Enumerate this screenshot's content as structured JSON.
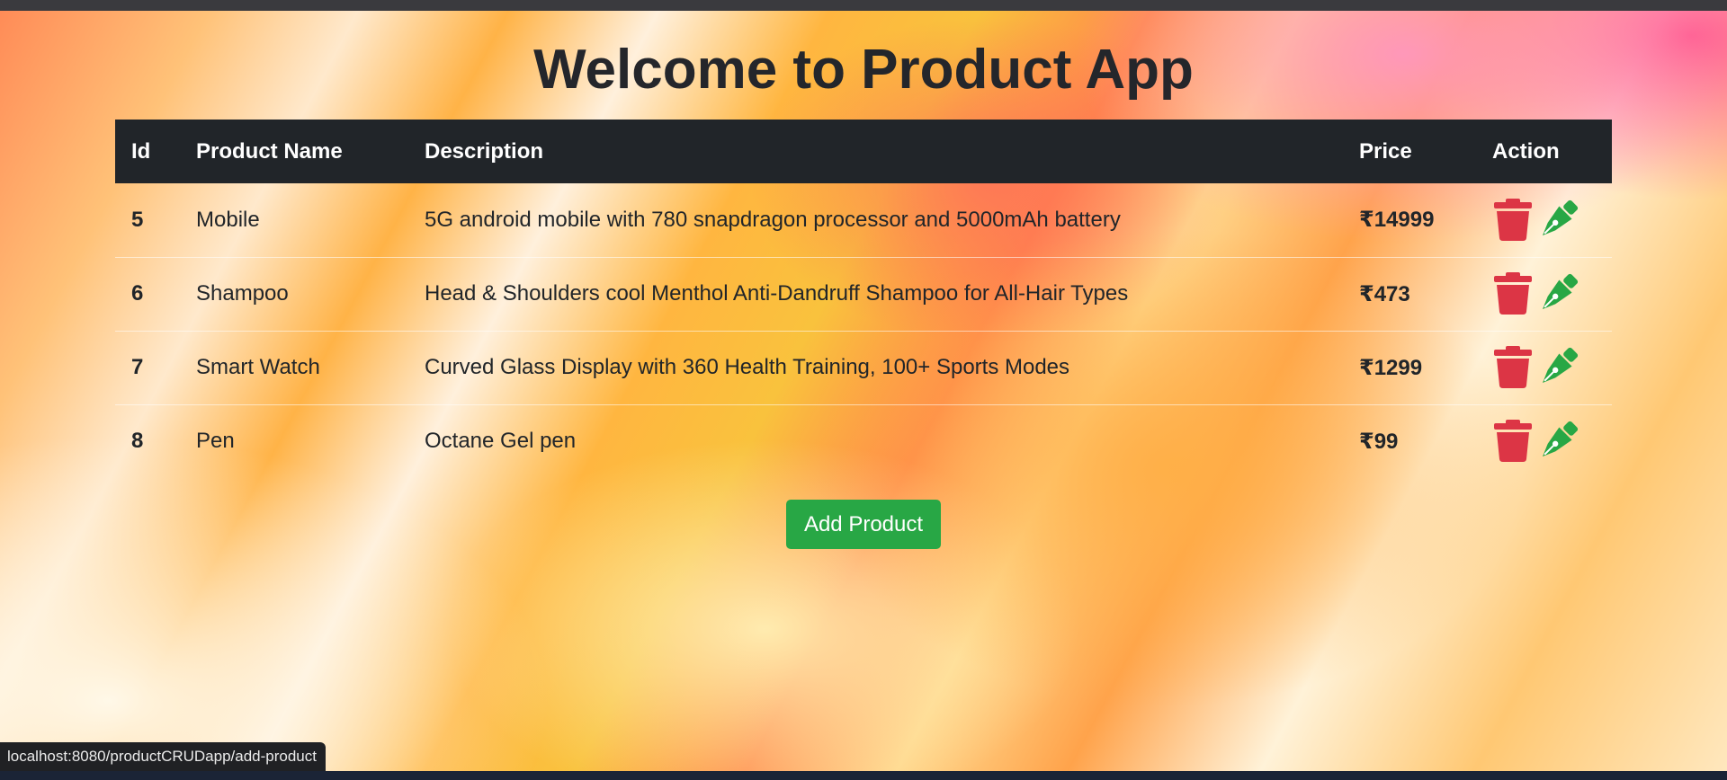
{
  "page": {
    "title": "Welcome to Product App"
  },
  "table": {
    "headers": {
      "id": "Id",
      "name": "Product Name",
      "description": "Description",
      "price": "Price",
      "action": "Action"
    },
    "rows": [
      {
        "id": "5",
        "name": "Mobile",
        "description": "5G android mobile with 780 snapdragon processor and 5000mAh battery",
        "price": "₹14999"
      },
      {
        "id": "6",
        "name": "Shampoo",
        "description": "Head & Shoulders cool Menthol Anti-Dandruff Shampoo for All-Hair Types",
        "price": "₹473"
      },
      {
        "id": "7",
        "name": "Smart Watch",
        "description": "Curved Glass Display with 360 Health Training, 100+ Sports Modes",
        "price": "₹1299"
      },
      {
        "id": "8",
        "name": "Pen",
        "description": "Octane Gel pen",
        "price": "₹99"
      }
    ],
    "action_icons": {
      "delete": "trash-icon",
      "edit": "pen-nib-icon"
    }
  },
  "add_button": {
    "label": "Add Product"
  },
  "status_bar": {
    "url": "localhost:8080/productCRUDapp/add-product"
  },
  "colors": {
    "header_bg": "#212529",
    "delete": "#dc3545",
    "edit": "#28a745",
    "button": "#28a745"
  }
}
